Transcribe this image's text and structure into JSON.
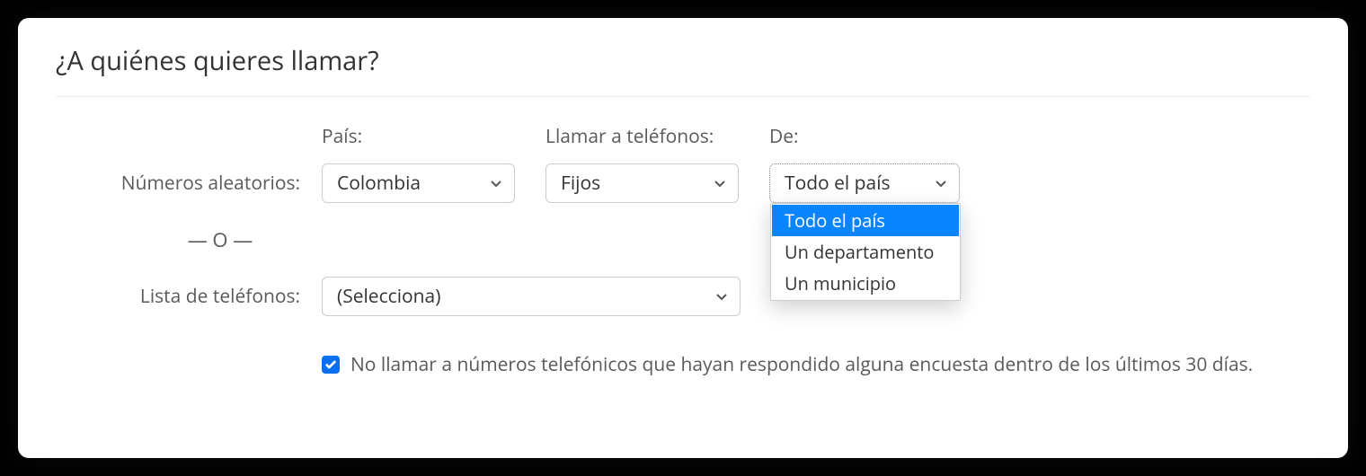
{
  "heading": "¿A quiénes quieres llamar?",
  "labels": {
    "random_numbers": "Números aleatorios:",
    "country": "País:",
    "call_phones": "Llamar a teléfonos:",
    "de": "De:",
    "phone_list": "Lista de teléfonos:",
    "divider": "— O —"
  },
  "selects": {
    "country": {
      "value": "Colombia"
    },
    "call_phones": {
      "value": "Fijos"
    },
    "de": {
      "value": "Todo el país",
      "options": [
        {
          "label": "Todo el país",
          "highlighted": true
        },
        {
          "label": "Un departamento",
          "highlighted": false
        },
        {
          "label": "Un municipio",
          "highlighted": false
        }
      ]
    },
    "phone_list": {
      "value": "(Selecciona)"
    }
  },
  "checkbox": {
    "checked": true,
    "label": "No llamar a números telefónicos que hayan respondido alguna encuesta dentro de los últimos 30 días."
  }
}
